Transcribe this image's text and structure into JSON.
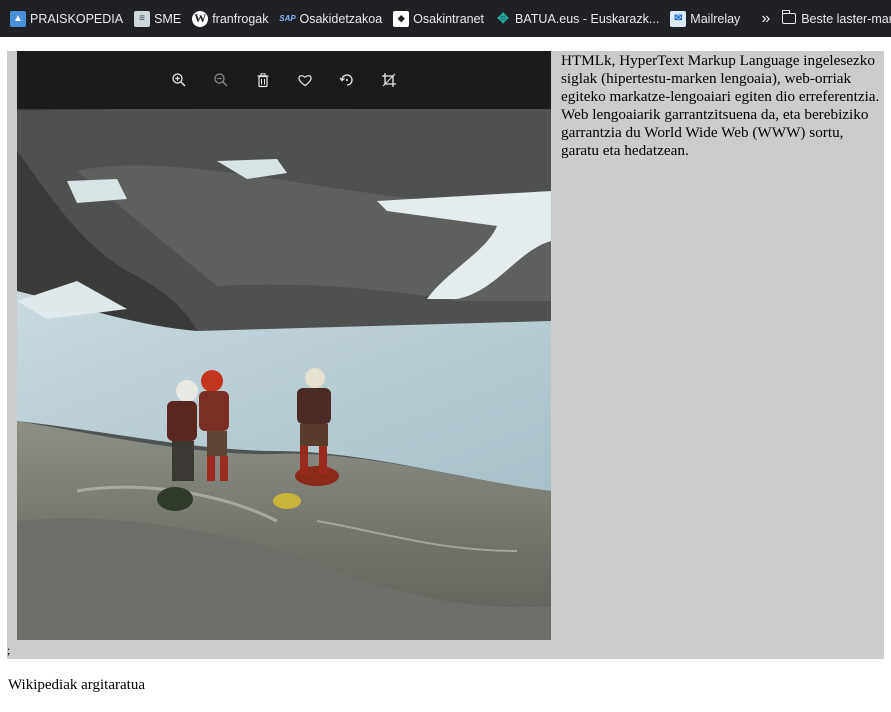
{
  "bookmarks_bar": {
    "items": [
      {
        "label": "PRAISKOPEDIA",
        "icon": "praiskopedia-icon"
      },
      {
        "label": "SME",
        "icon": "sme-icon"
      },
      {
        "label": "franfrogak",
        "icon": "wordpress-icon"
      },
      {
        "label": "Osakidetzakoa",
        "icon": "sap-icon"
      },
      {
        "label": "Osakintranet",
        "icon": "osakintranet-icon"
      },
      {
        "label": "BATUA.eus - Euskarazk...",
        "icon": "batua-icon"
      },
      {
        "label": "Mailrelay",
        "icon": "mailrelay-icon"
      }
    ],
    "more_icon": "chevron-double-right-icon",
    "other_bookmarks_label": "Beste laster-markak"
  },
  "image_viewer": {
    "toolbar": [
      "zoom-in-icon",
      "zoom-out-icon",
      "trash-icon",
      "heart-icon",
      "rotate-icon",
      "crop-icon"
    ],
    "photo_subject": "climbers-on-glacier-photo"
  },
  "article": {
    "paragraph": "HTMLk, HyperText Markup Language ingelesezko siglak (hipertestu-marken lengoaia), web-orriak egiteko markatze-lengoaiari egiten dio erreferentzia. Web lengoaiarik garrantzitsuena da, eta berebiziko garrantzia du World Wide Web (WWW) sortu, garatu eta hedatzean.",
    "stray_char": ";"
  },
  "footer": {
    "text": "Wikipediak argitaratua"
  },
  "colors": {
    "bookmarks_bg": "#202124",
    "content_box_bg": "#cccccc",
    "toolbar_bg": "#18181a"
  }
}
